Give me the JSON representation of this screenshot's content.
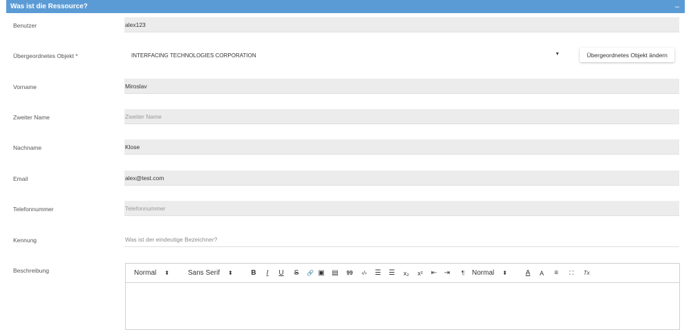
{
  "header": {
    "title": "Was ist die Ressource?",
    "collapse": "–"
  },
  "fields": {
    "benutzer": {
      "label": "Benutzer",
      "value": "alex123"
    },
    "parent": {
      "label": "Übergeordnetes Objekt *",
      "value": "INTERFACING TECHNOLOGIES CORPORATION",
      "button": "Übergeordnetes Objekt ändern"
    },
    "vorname": {
      "label": "Vorname",
      "value": "Miroslav"
    },
    "zweiter": {
      "label": "Zweiter Name",
      "placeholder": "Zweiter Name"
    },
    "nachname": {
      "label": "Nachname",
      "value": "Klose"
    },
    "email": {
      "label": "Email",
      "value": "alex@test.com"
    },
    "telefon": {
      "label": "Telefonnummer",
      "placeholder": "Telefonnummer"
    },
    "kennung": {
      "label": "Kennung",
      "placeholder": "Was ist der eindeutige Bezeichner?"
    },
    "beschreibung": {
      "label": "Beschreibung"
    }
  },
  "toolbar": {
    "size": "Normal",
    "font": "Sans Serif",
    "heading": "Normal",
    "bold": "B",
    "italic": "I",
    "underline": "U",
    "strike": "S",
    "link": "🔗",
    "image": "▣",
    "video": "▤",
    "quote": "99",
    "code": "‹/›",
    "ordered": "☰",
    "bullet": "☰",
    "sub": "x₂",
    "sup": "x²",
    "outdent": "⇤",
    "indent": "⇥",
    "direction": "¶",
    "color": "A",
    "background": "A",
    "align": "≡",
    "fullscreen": "⛶",
    "clean": "Tx"
  }
}
